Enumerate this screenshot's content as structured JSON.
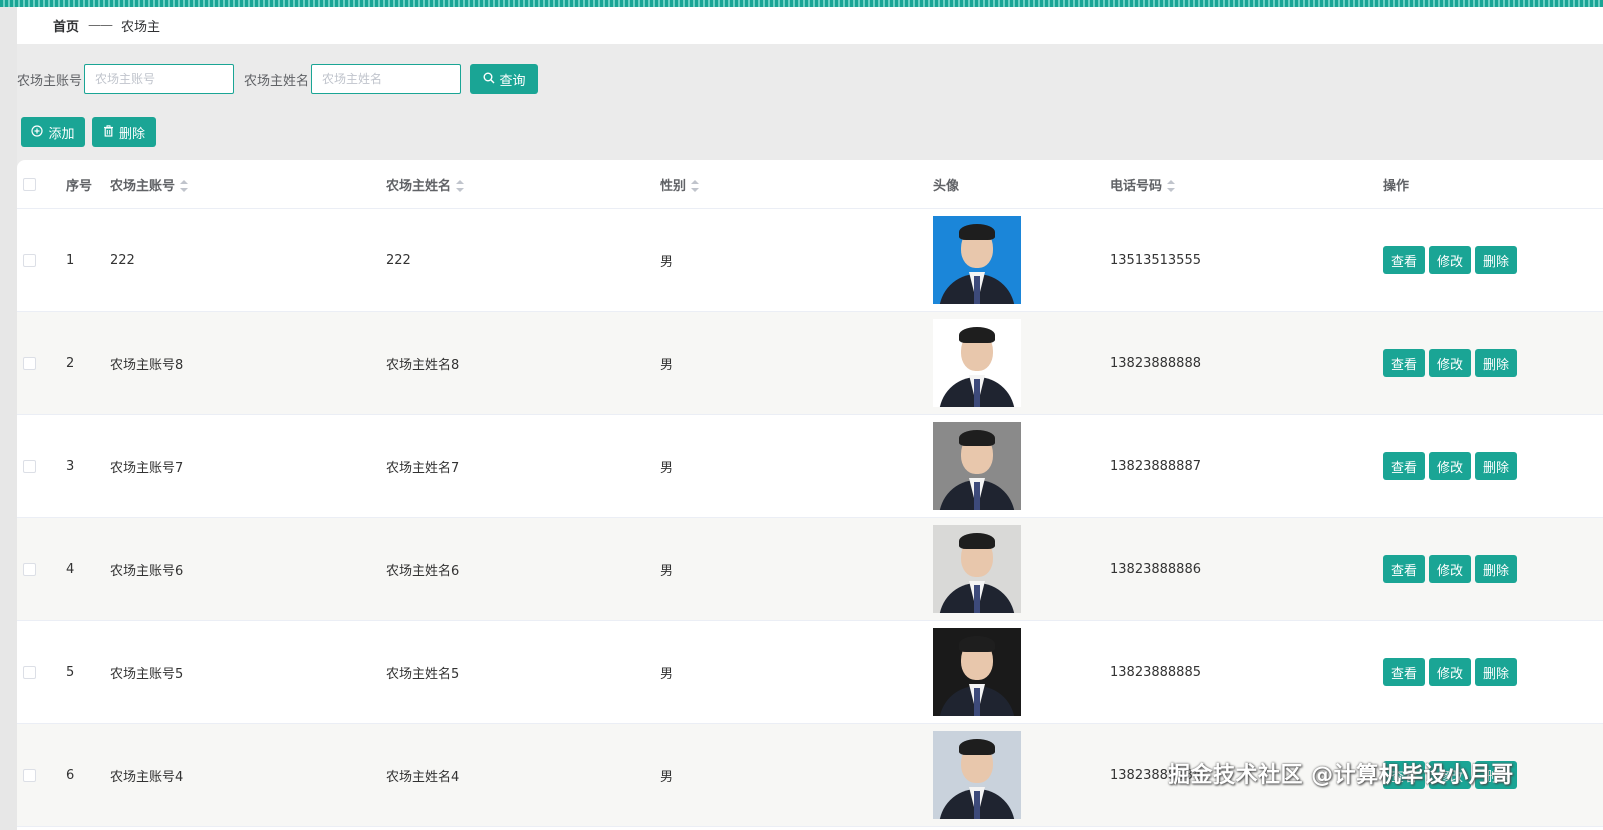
{
  "breadcrumb": {
    "home": "首页",
    "separator": "——",
    "current": "农场主"
  },
  "search": {
    "account_label": "农场主账号",
    "account_placeholder": "农场主账号",
    "account_value": "",
    "name_label": "农场主姓名",
    "name_placeholder": "农场主姓名",
    "name_value": "",
    "query_button": "查询",
    "query_icon": "search-icon"
  },
  "actions": {
    "add_label": "添加",
    "add_icon": "plus-circle-icon",
    "delete_label": "删除",
    "delete_icon": "trash-icon"
  },
  "table": {
    "columns": {
      "index": "序号",
      "account": "农场主账号",
      "name": "农场主姓名",
      "gender": "性别",
      "avatar": "头像",
      "phone": "电话号码",
      "ops": "操作"
    },
    "row_buttons": {
      "view": "查看",
      "edit": "修改",
      "delete": "删除"
    },
    "rows": [
      {
        "index": "1",
        "account": "222",
        "name": "222",
        "gender": "男",
        "phone": "13513513555",
        "avatar_bg": "#1b86d9"
      },
      {
        "index": "2",
        "account": "农场主账号8",
        "name": "农场主姓名8",
        "gender": "男",
        "phone": "13823888888",
        "avatar_bg": "#ffffff"
      },
      {
        "index": "3",
        "account": "农场主账号7",
        "name": "农场主姓名7",
        "gender": "男",
        "phone": "13823888887",
        "avatar_bg": "#8a8a8a"
      },
      {
        "index": "4",
        "account": "农场主账号6",
        "name": "农场主姓名6",
        "gender": "男",
        "phone": "13823888886",
        "avatar_bg": "#d9d9d7"
      },
      {
        "index": "5",
        "account": "农场主账号5",
        "name": "农场主姓名5",
        "gender": "男",
        "phone": "13823888885",
        "avatar_bg": "#1a1a1a"
      },
      {
        "index": "6",
        "account": "农场主账号4",
        "name": "农场主姓名4",
        "gender": "男",
        "phone": "13823888884",
        "avatar_bg": "#c9d2dc"
      }
    ]
  },
  "watermark": "掘金技术社区 @计算机毕设小月哥",
  "colors": {
    "accent": "#1aa595"
  }
}
